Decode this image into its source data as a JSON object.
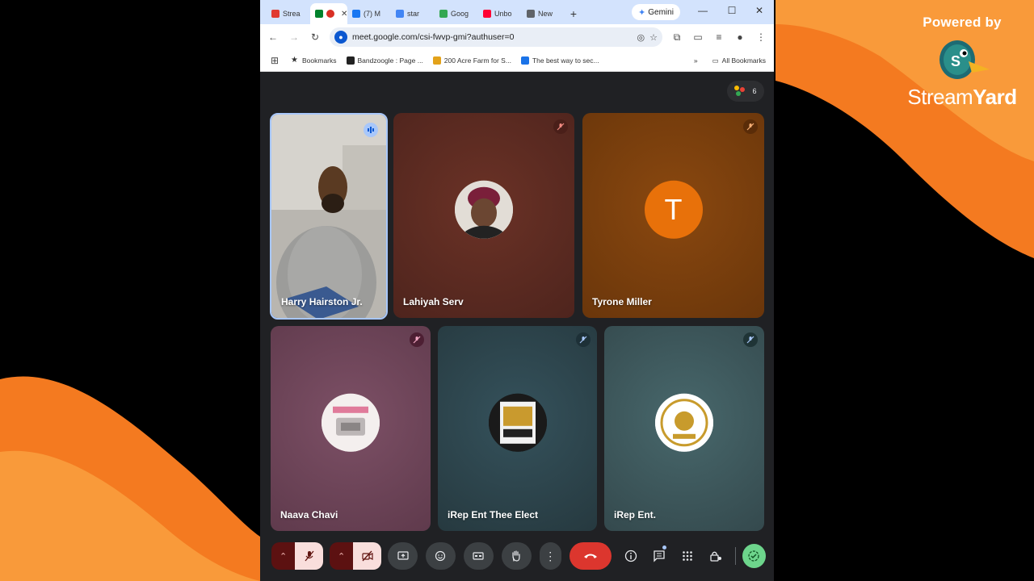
{
  "overlay": {
    "powered_by": "Powered by",
    "brand_stream": "Stream",
    "brand_yard": "Yard",
    "colors": {
      "orange": "#f47a20",
      "orange_light": "#f99a3a"
    }
  },
  "browser": {
    "tabs": [
      {
        "label": "Strea",
        "icon": "streamyard-favicon",
        "color": "#e03a2f"
      },
      {
        "label": "",
        "icon": "meet-recording-favicon",
        "color": "#00832d",
        "active": true
      },
      {
        "label": "(7) M",
        "icon": "facebook-favicon",
        "color": "#1877f2"
      },
      {
        "label": "star",
        "icon": "google-favicon",
        "color": "#4285f4"
      },
      {
        "label": "Goog",
        "icon": "google-maps-favicon",
        "color": "#34a853"
      },
      {
        "label": "Unbo",
        "icon": "youtube-favicon",
        "color": "#ff0033"
      },
      {
        "label": "New",
        "icon": "chrome-favicon",
        "color": "#5f6368"
      }
    ],
    "gemini_label": "Gemini",
    "url": "meet.google.com/csi-fwvp-gmi?authuser=0",
    "bookmarks": [
      {
        "label": "Bookmarks",
        "icon": "star-icon"
      },
      {
        "label": "Bandzoogle : Page ...",
        "icon": "bandzoogle-favicon"
      },
      {
        "label": "200 Acre Farm for S...",
        "icon": "sunglasses-emoji"
      },
      {
        "label": "The best way to sec...",
        "icon": "blue-favicon"
      }
    ],
    "all_bookmarks": "All Bookmarks"
  },
  "meet": {
    "participant_count": "6",
    "tiles": [
      {
        "name": "Harry Hairston Jr.",
        "kind": "video",
        "speaking": true,
        "bg": "#9aa0a6"
      },
      {
        "name": "Lahiyah Serv",
        "kind": "photo",
        "bg": "#5a2a22"
      },
      {
        "name": "Tyrone Miller",
        "kind": "letter",
        "initial": "T",
        "bg": "#7a3f0d"
      },
      {
        "name": "Naava Chavi",
        "kind": "logo",
        "bg": "#6f4659"
      },
      {
        "name": "iRep Ent Thee Elect",
        "kind": "logo",
        "bg": "#2f4952"
      },
      {
        "name": "iRep Ent.",
        "kind": "logo",
        "bg": "#3f5a5e"
      }
    ]
  }
}
